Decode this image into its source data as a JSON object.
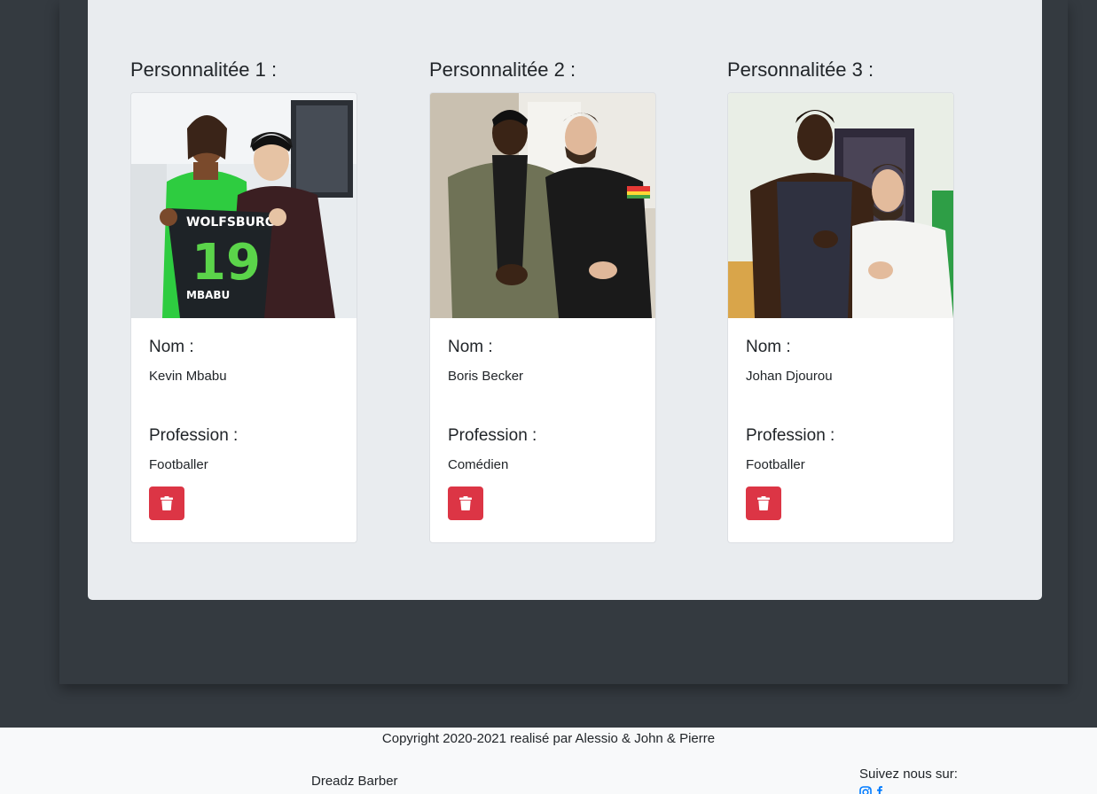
{
  "cards": [
    {
      "title": "Personnalitée 1 :",
      "name_label": "Nom :",
      "name": "Kevin Mbabu",
      "profession_label": "Profession :",
      "profession": "Footballer",
      "photo": "photo-footballer-jersey-wolfsburg-19"
    },
    {
      "title": "Personnalitée 2 :",
      "name_label": "Nom :",
      "name": "Boris Becker",
      "profession_label": "Profession :",
      "profession": "Comédien",
      "photo": "photo-two-men-hotel-room"
    },
    {
      "title": "Personnalitée 3 :",
      "name_label": "Nom :",
      "name": "Johan Djourou",
      "profession_label": "Profession :",
      "profession": "Footballer",
      "photo": "photo-two-men-thumbs-up"
    }
  ],
  "icons": {
    "delete": "trash-icon",
    "instagram": "instagram-icon",
    "facebook": "facebook-icon"
  },
  "colors": {
    "danger": "#dc3545",
    "link": "#007bff",
    "dark_bg": "#343a40",
    "panel_bg": "#e9ecef",
    "footer_bg": "#f8f9fa"
  },
  "footer": {
    "copyright": "Copyright 2020-2021 realisé par Alessio & John & Pierre",
    "brand": "Dreadz Barber",
    "follow": "Suivez nous sur:"
  }
}
